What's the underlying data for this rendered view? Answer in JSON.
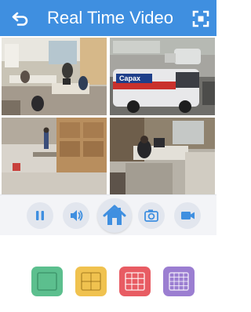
{
  "header": {
    "title": "Real Time Video",
    "back_icon": "back-arrow-icon",
    "fullscreen_icon": "fullscreen-icon",
    "color": "#3f8fe0"
  },
  "cameras": [
    {
      "scene": "office-interior"
    },
    {
      "scene": "parking-lot-van"
    },
    {
      "scene": "warehouse-floor"
    },
    {
      "scene": "office-desk"
    }
  ],
  "van_sign": "Capax",
  "controls": [
    {
      "icon": "pause-icon"
    },
    {
      "icon": "volume-icon"
    },
    {
      "icon": "home-icon"
    },
    {
      "icon": "camera-icon"
    },
    {
      "icon": "video-record-icon"
    }
  ],
  "control_icon_color": "#3f8fe0",
  "layout_buttons": [
    {
      "icon": "single-view-icon",
      "color": "#5cbf8e"
    },
    {
      "icon": "quad-view-icon",
      "color": "#f0c24f"
    },
    {
      "icon": "nine-view-icon",
      "color": "#e85c63"
    },
    {
      "icon": "sixteen-view-icon",
      "color": "#9b7ed1"
    }
  ]
}
